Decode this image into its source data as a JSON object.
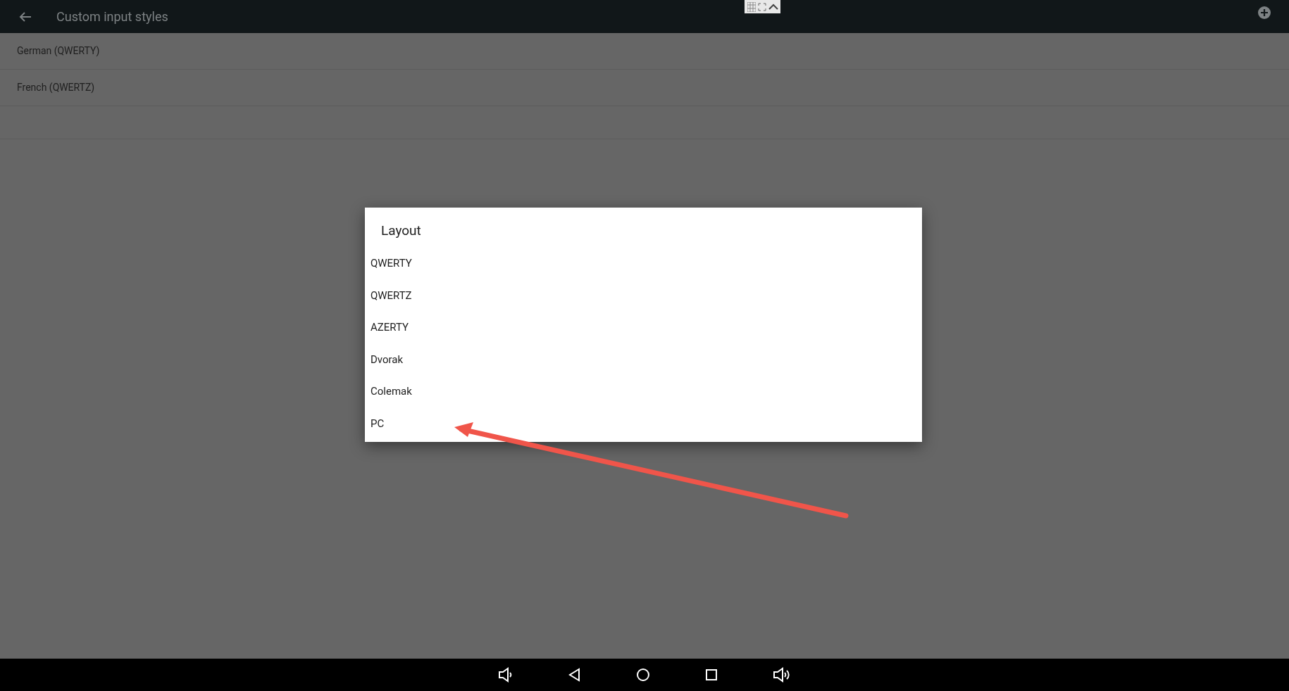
{
  "app_bar": {
    "title": "Custom input styles"
  },
  "styles": [
    {
      "label": "German (QWERTY)"
    },
    {
      "label": "French (QWERTZ)"
    }
  ],
  "dialog": {
    "title": "Layout",
    "options": [
      {
        "label": "QWERTY"
      },
      {
        "label": "QWERTZ"
      },
      {
        "label": "AZERTY"
      },
      {
        "label": "Dvorak"
      },
      {
        "label": "Colemak"
      },
      {
        "label": "PC"
      }
    ]
  }
}
